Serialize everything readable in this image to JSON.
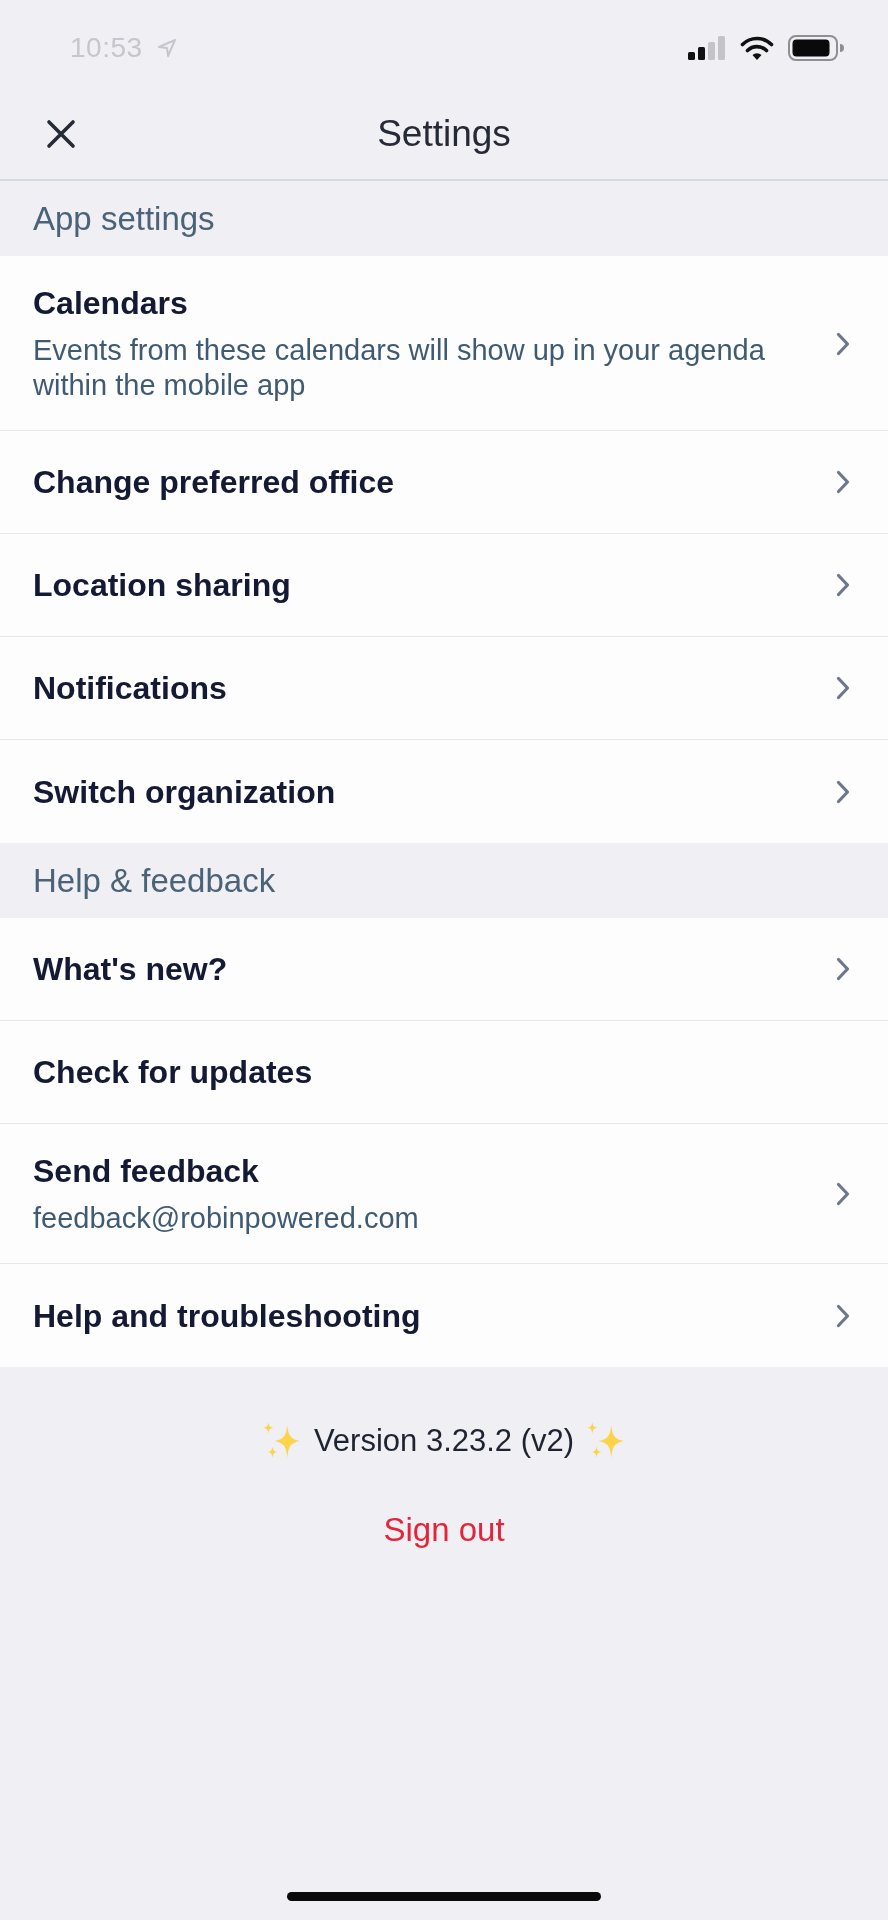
{
  "status_bar": {
    "time": "10:53"
  },
  "header": {
    "title": "Settings"
  },
  "sections": [
    {
      "title": "App settings",
      "items": [
        {
          "title": "Calendars",
          "subtitle": "Events from these calendars will show up in your agenda within the mobile app",
          "chevron": true
        },
        {
          "title": "Change preferred office",
          "chevron": true
        },
        {
          "title": "Location sharing",
          "chevron": true
        },
        {
          "title": "Notifications",
          "chevron": true
        },
        {
          "title": "Switch organization",
          "chevron": true
        }
      ]
    },
    {
      "title": "Help & feedback",
      "items": [
        {
          "title": "What's new?",
          "chevron": true
        },
        {
          "title": "Check for updates",
          "chevron": false
        },
        {
          "title": "Send feedback",
          "subtitle": "feedback@robinpowered.com",
          "chevron": true
        },
        {
          "title": "Help and troubleshooting",
          "chevron": true
        }
      ]
    }
  ],
  "footer": {
    "version": "Version 3.23.2 (v2)",
    "sign_out": "Sign out"
  }
}
